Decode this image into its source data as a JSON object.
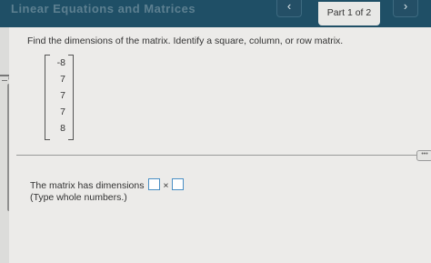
{
  "header": {
    "title": "Linear Equations and Matrices",
    "prev_label": "‹",
    "next_label": "›",
    "part_label": "Part 1 of 2"
  },
  "question": {
    "prompt": "Find the dimensions of the matrix. Identify a square, column, or row matrix.",
    "matrix": [
      "-8",
      "7",
      "7",
      "7",
      "8"
    ]
  },
  "answer": {
    "label": "The matrix has dimensions",
    "times_symbol": "×",
    "rows_value": "",
    "cols_value": "",
    "hint": "(Type whole numbers.)"
  },
  "colors": {
    "header_bg": "#1f4f66",
    "input_border": "#4a8fc4"
  }
}
